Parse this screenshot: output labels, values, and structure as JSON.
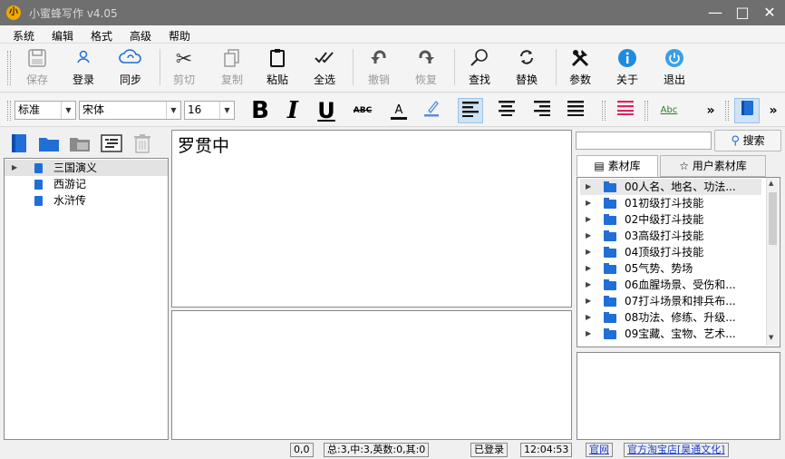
{
  "window": {
    "title": "小蜜蜂写作 v4.05",
    "logo_char": "小",
    "minimize": "—",
    "maximize": "□",
    "close": "✕"
  },
  "menu": [
    "系统",
    "编辑",
    "格式",
    "高级",
    "帮助"
  ],
  "toolbar": {
    "save": "保存",
    "login": "登录",
    "sync": "同步",
    "cut": "剪切",
    "copy": "复制",
    "paste": "粘贴",
    "select_all": "全选",
    "undo": "撤销",
    "redo": "恢复",
    "find": "查找",
    "replace": "替换",
    "params": "参数",
    "about": "关于",
    "exit": "退出"
  },
  "format": {
    "style": "标准",
    "font": "宋体",
    "size": "16",
    "bold": "B",
    "italic": "I",
    "underline": "U",
    "strike": "ABC",
    "font_color": "A",
    "spell": "Abc",
    "more": "»"
  },
  "tree": {
    "items": [
      "三国演义",
      "西游记",
      "水浒传"
    ]
  },
  "editor": {
    "text": "罗贯中"
  },
  "search": {
    "value": "",
    "button": "搜索"
  },
  "tabs": {
    "material": "素材库",
    "user_material": "用户素材库"
  },
  "library": [
    "00人名、地名、功法...",
    "01初级打斗技能",
    "02中级打斗技能",
    "03高级打斗技能",
    "04顶级打斗技能",
    "05气势、势场",
    "06血腥场景、受伤和...",
    "07打斗场景和排兵布...",
    "08功法、修练、升级...",
    "09宝藏、宝物、艺术..."
  ],
  "status": {
    "pos": "0,0",
    "counts": "总:3,中:3,英数:0,其:0",
    "login": "已登录",
    "time": "12:04:53",
    "site": "官网",
    "shop": "官方淘宝店[昊通文化]"
  },
  "colors": {
    "titlebar": "#6f6f6f",
    "accent_blue": "#1f6fd6",
    "link": "#1a3cc8"
  }
}
